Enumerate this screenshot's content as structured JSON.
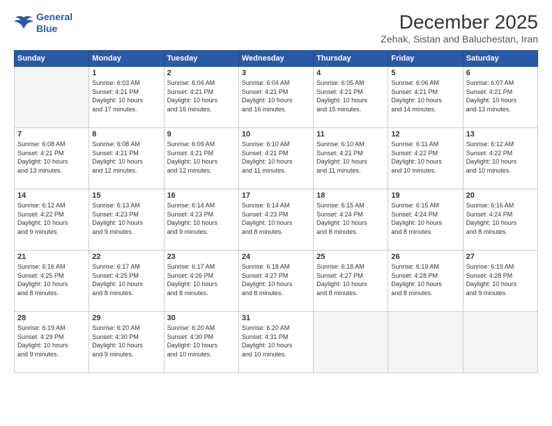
{
  "logo": {
    "line1": "General",
    "line2": "Blue"
  },
  "title": "December 2025",
  "subtitle": "Zehak, Sistan and Baluchestan, Iran",
  "headers": [
    "Sunday",
    "Monday",
    "Tuesday",
    "Wednesday",
    "Thursday",
    "Friday",
    "Saturday"
  ],
  "weeks": [
    [
      {
        "day": "",
        "info": ""
      },
      {
        "day": "1",
        "info": "Sunrise: 6:03 AM\nSunset: 4:21 PM\nDaylight: 10 hours\nand 17 minutes."
      },
      {
        "day": "2",
        "info": "Sunrise: 6:04 AM\nSunset: 4:21 PM\nDaylight: 10 hours\nand 16 minutes."
      },
      {
        "day": "3",
        "info": "Sunrise: 6:04 AM\nSunset: 4:21 PM\nDaylight: 10 hours\nand 16 minutes."
      },
      {
        "day": "4",
        "info": "Sunrise: 6:05 AM\nSunset: 4:21 PM\nDaylight: 10 hours\nand 15 minutes."
      },
      {
        "day": "5",
        "info": "Sunrise: 6:06 AM\nSunset: 4:21 PM\nDaylight: 10 hours\nand 14 minutes."
      },
      {
        "day": "6",
        "info": "Sunrise: 6:07 AM\nSunset: 4:21 PM\nDaylight: 10 hours\nand 13 minutes."
      }
    ],
    [
      {
        "day": "7",
        "info": "Sunrise: 6:08 AM\nSunset: 4:21 PM\nDaylight: 10 hours\nand 13 minutes."
      },
      {
        "day": "8",
        "info": "Sunrise: 6:08 AM\nSunset: 4:21 PM\nDaylight: 10 hours\nand 12 minutes."
      },
      {
        "day": "9",
        "info": "Sunrise: 6:09 AM\nSunset: 4:21 PM\nDaylight: 10 hours\nand 12 minutes."
      },
      {
        "day": "10",
        "info": "Sunrise: 6:10 AM\nSunset: 4:21 PM\nDaylight: 10 hours\nand 11 minutes."
      },
      {
        "day": "11",
        "info": "Sunrise: 6:10 AM\nSunset: 4:21 PM\nDaylight: 10 hours\nand 11 minutes."
      },
      {
        "day": "12",
        "info": "Sunrise: 6:11 AM\nSunset: 4:22 PM\nDaylight: 10 hours\nand 10 minutes."
      },
      {
        "day": "13",
        "info": "Sunrise: 6:12 AM\nSunset: 4:22 PM\nDaylight: 10 hours\nand 10 minutes."
      }
    ],
    [
      {
        "day": "14",
        "info": "Sunrise: 6:12 AM\nSunset: 4:22 PM\nDaylight: 10 hours\nand 9 minutes."
      },
      {
        "day": "15",
        "info": "Sunrise: 6:13 AM\nSunset: 4:23 PM\nDaylight: 10 hours\nand 9 minutes."
      },
      {
        "day": "16",
        "info": "Sunrise: 6:14 AM\nSunset: 4:23 PM\nDaylight: 10 hours\nand 9 minutes."
      },
      {
        "day": "17",
        "info": "Sunrise: 6:14 AM\nSunset: 4:23 PM\nDaylight: 10 hours\nand 8 minutes."
      },
      {
        "day": "18",
        "info": "Sunrise: 6:15 AM\nSunset: 4:24 PM\nDaylight: 10 hours\nand 8 minutes."
      },
      {
        "day": "19",
        "info": "Sunrise: 6:15 AM\nSunset: 4:24 PM\nDaylight: 10 hours\nand 8 minutes."
      },
      {
        "day": "20",
        "info": "Sunrise: 6:16 AM\nSunset: 4:24 PM\nDaylight: 10 hours\nand 8 minutes."
      }
    ],
    [
      {
        "day": "21",
        "info": "Sunrise: 6:16 AM\nSunset: 4:25 PM\nDaylight: 10 hours\nand 8 minutes."
      },
      {
        "day": "22",
        "info": "Sunrise: 6:17 AM\nSunset: 4:25 PM\nDaylight: 10 hours\nand 8 minutes."
      },
      {
        "day": "23",
        "info": "Sunrise: 6:17 AM\nSunset: 4:26 PM\nDaylight: 10 hours\nand 8 minutes."
      },
      {
        "day": "24",
        "info": "Sunrise: 6:18 AM\nSunset: 4:27 PM\nDaylight: 10 hours\nand 8 minutes."
      },
      {
        "day": "25",
        "info": "Sunrise: 6:18 AM\nSunset: 4:27 PM\nDaylight: 10 hours\nand 8 minutes."
      },
      {
        "day": "26",
        "info": "Sunrise: 6:19 AM\nSunset: 4:28 PM\nDaylight: 10 hours\nand 8 minutes."
      },
      {
        "day": "27",
        "info": "Sunrise: 6:19 AM\nSunset: 4:28 PM\nDaylight: 10 hours\nand 9 minutes."
      }
    ],
    [
      {
        "day": "28",
        "info": "Sunrise: 6:19 AM\nSunset: 4:29 PM\nDaylight: 10 hours\nand 9 minutes."
      },
      {
        "day": "29",
        "info": "Sunrise: 6:20 AM\nSunset: 4:30 PM\nDaylight: 10 hours\nand 9 minutes."
      },
      {
        "day": "30",
        "info": "Sunrise: 6:20 AM\nSunset: 4:30 PM\nDaylight: 10 hours\nand 10 minutes."
      },
      {
        "day": "31",
        "info": "Sunrise: 6:20 AM\nSunset: 4:31 PM\nDaylight: 10 hours\nand 10 minutes."
      },
      {
        "day": "",
        "info": ""
      },
      {
        "day": "",
        "info": ""
      },
      {
        "day": "",
        "info": ""
      }
    ]
  ]
}
